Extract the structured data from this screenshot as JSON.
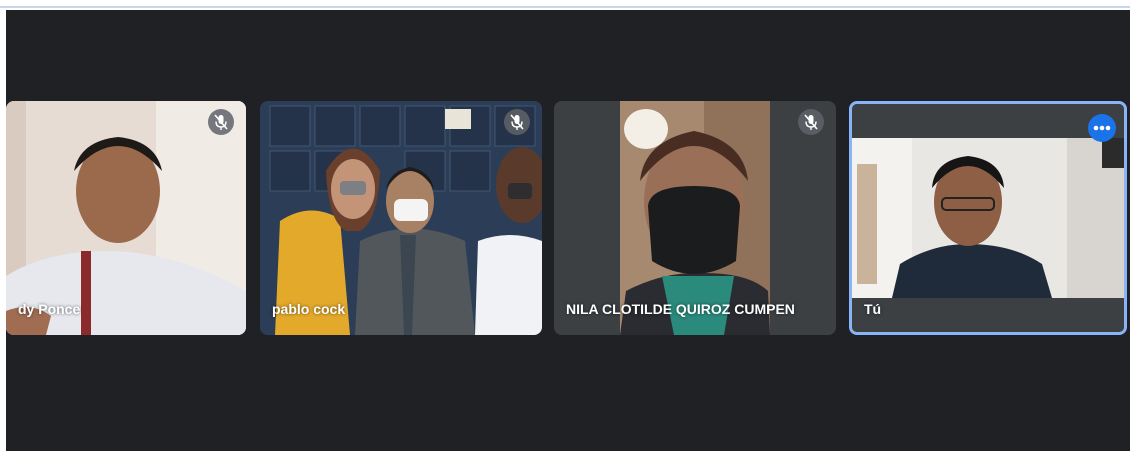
{
  "participants": [
    {
      "name": "dy Ponce",
      "muted": true
    },
    {
      "name": "pablo cock",
      "muted": true
    },
    {
      "name": "NILA CLOTILDE QUIROZ CUMPEN",
      "muted": true
    },
    {
      "name": "Tú",
      "muted": false,
      "active_speaker": true
    }
  ],
  "colors": {
    "background": "#202124",
    "tile": "#3c4043",
    "active_border": "#8ab4f8",
    "more_button": "#1a73e8"
  },
  "icons": {
    "muted": "mic-off-icon",
    "more": "more-options-icon"
  }
}
